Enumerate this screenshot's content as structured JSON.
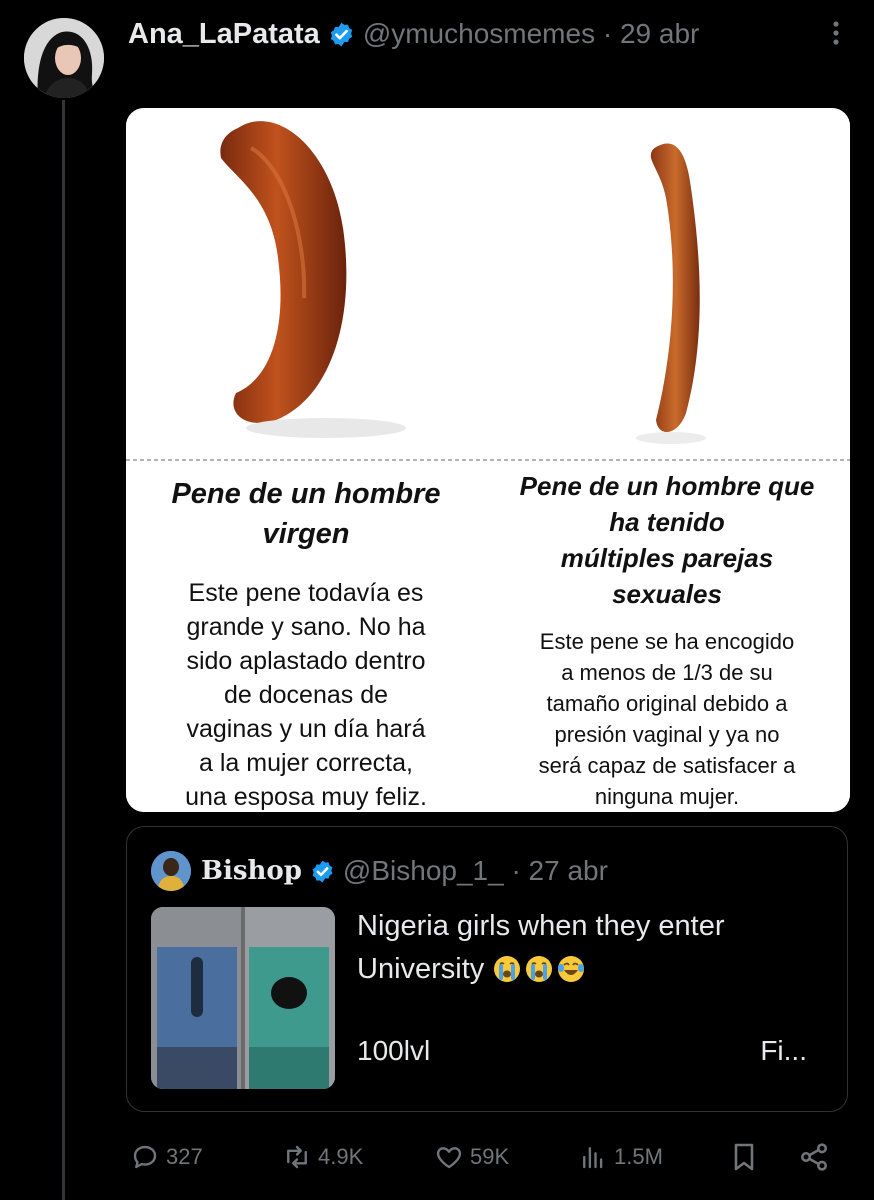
{
  "tweet": {
    "author_name": "Ana_LaPatata",
    "handle_date": "@ymuchosmemes · 29 abr",
    "image": {
      "left_title": [
        "Pene de un hombre",
        "virgen"
      ],
      "left_body": [
        "Este pene todavía es",
        "grande y sano. No ha",
        "sido aplastado dentro",
        "de docenas de",
        "vaginas y un día hará",
        "a la mujer correcta,",
        "una esposa muy feliz."
      ],
      "right_title": [
        "Pene de un hombre que",
        "ha tenido",
        "múltiples parejas",
        "sexuales"
      ],
      "right_body": [
        "Este pene se ha encogido",
        "a menos de 1/3 de su",
        "tamaño original debido a",
        "presión vaginal y ya no",
        "será capaz de satisfacer a",
        "ninguna mujer."
      ]
    }
  },
  "quote": {
    "author_name": "Bishop",
    "handle_date": "@Bishop_1_ · 27 abr",
    "text": "Nigeria girls when they enter University",
    "emojis": [
      "loudly-crying-face",
      "loudly-crying-face",
      "face-with-tears-of-joy"
    ],
    "subtext": "100lvl",
    "truncated": "Fi..."
  },
  "actions": {
    "replies": "327",
    "reposts": "4.9K",
    "likes": "59K",
    "views": "1.5M"
  },
  "colors": {
    "background": "#000000",
    "text": "#e7e9ea",
    "muted": "#71767b",
    "verified": "#1d9bf0",
    "border": "#2f3336"
  }
}
